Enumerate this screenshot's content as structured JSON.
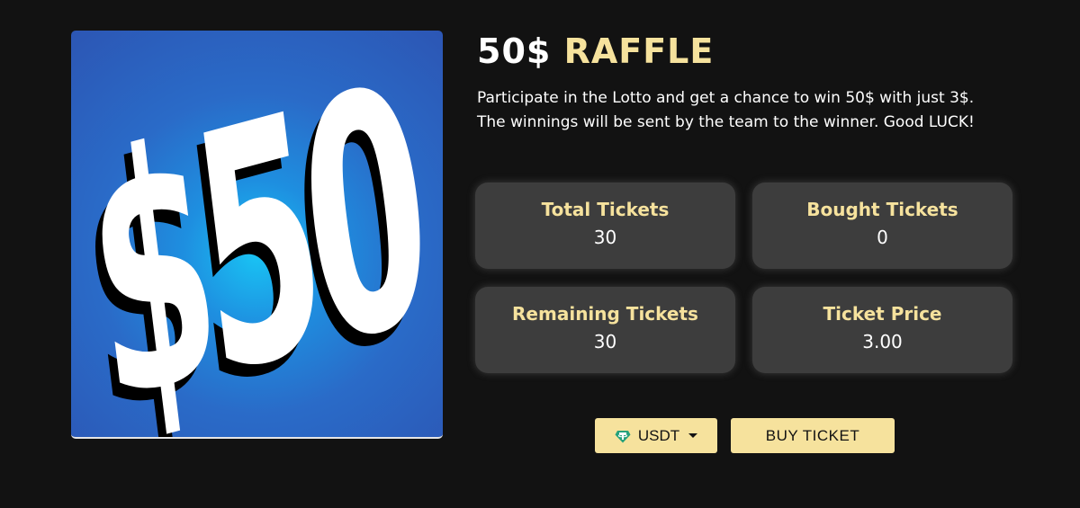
{
  "hero": {
    "image_text": "$50",
    "image_alt_icon": "fifty-dollar-image"
  },
  "raffle": {
    "title_amount": "50$",
    "title_word": "RAFFLE",
    "description_line1": "Participate in the Lotto and get a chance to win 50$ with just 3$.",
    "description_line2": "The winnings will be sent by the team to the winner. Good LUCK!"
  },
  "stats": {
    "total": {
      "label": "Total Tickets",
      "value": "30"
    },
    "bought": {
      "label": "Bought Tickets",
      "value": "0"
    },
    "remaining": {
      "label": "Remaining Tickets",
      "value": "30"
    },
    "price": {
      "label": "Ticket Price",
      "value": "3.00"
    }
  },
  "actions": {
    "currency": "USDT",
    "currency_icon": "tether-icon",
    "buy_label": "BUY TICKET"
  },
  "colors": {
    "background": "#121212",
    "accent": "#f6e29d",
    "card": "#3d3d3d"
  }
}
